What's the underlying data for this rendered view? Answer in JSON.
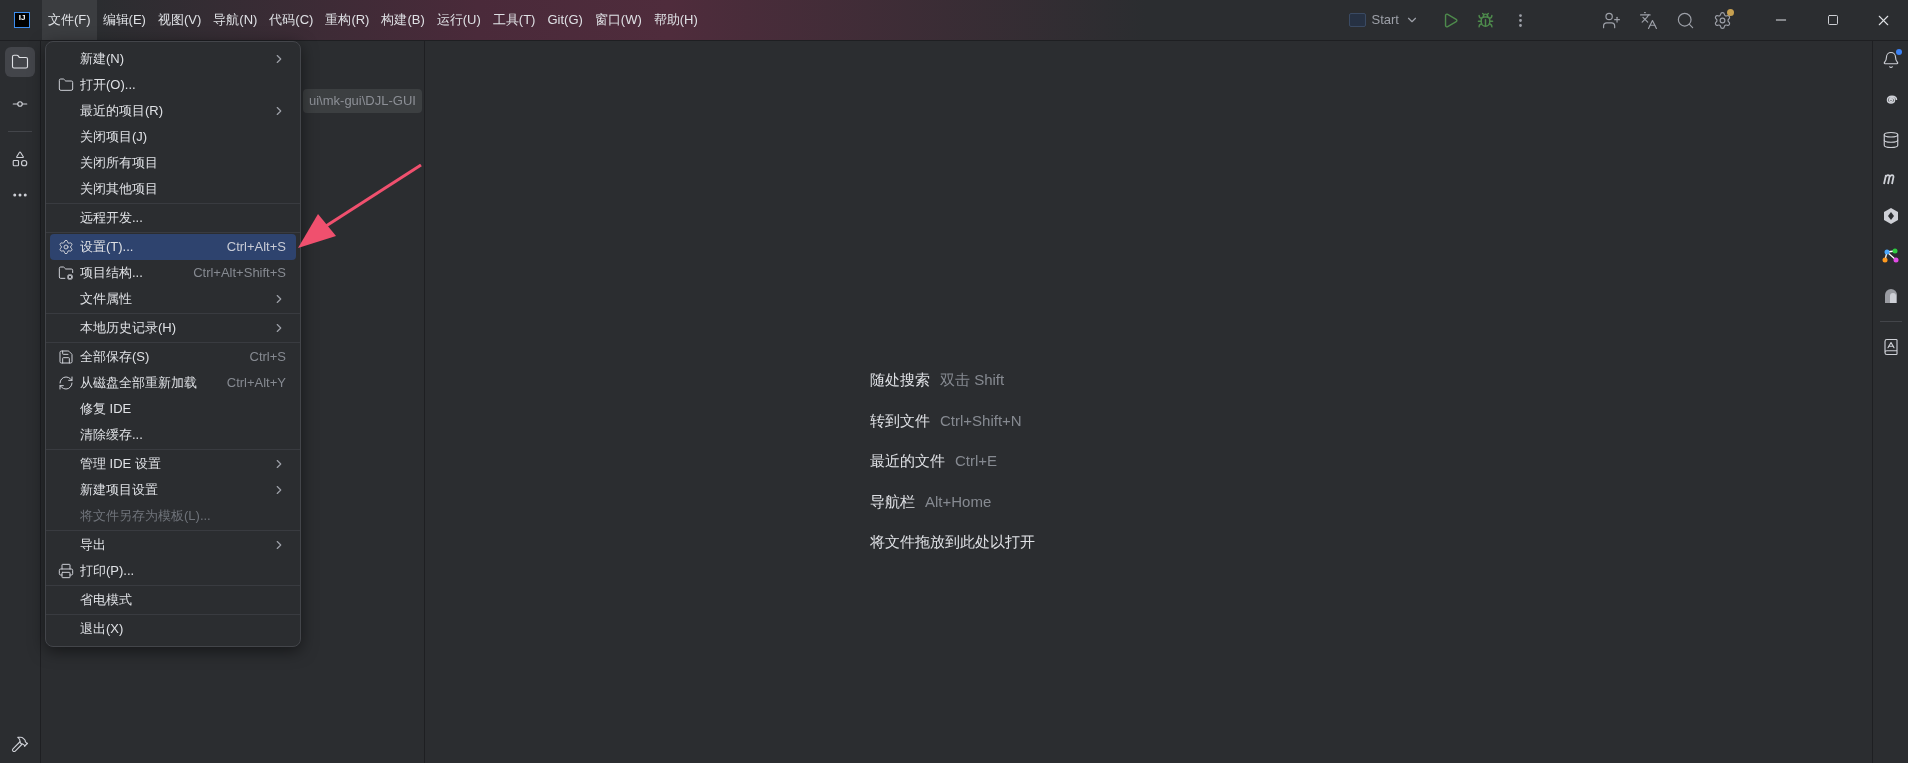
{
  "app_logo": {
    "text": "IJ"
  },
  "menu_bar": [
    {
      "label": "文件(F)",
      "selected": true
    },
    {
      "label": "编辑(E)",
      "selected": false
    },
    {
      "label": "视图(V)",
      "selected": false
    },
    {
      "label": "导航(N)",
      "selected": false
    },
    {
      "label": "代码(C)",
      "selected": false
    },
    {
      "label": "重构(R)",
      "selected": false
    },
    {
      "label": "构建(B)",
      "selected": false
    },
    {
      "label": "运行(U)",
      "selected": false
    },
    {
      "label": "工具(T)",
      "selected": false
    },
    {
      "label": "Git(G)",
      "selected": false
    },
    {
      "label": "窗口(W)",
      "selected": false
    },
    {
      "label": "帮助(H)",
      "selected": false
    }
  ],
  "run_config": {
    "label": "Start"
  },
  "project_path": "ui\\mk-gui\\DJL-GUI",
  "file_menu": [
    {
      "kind": "plain",
      "label": "新建(N)",
      "submenu": true,
      "selected": false,
      "disabled": false
    },
    {
      "kind": "folder",
      "label": "打开(O)...",
      "submenu": false,
      "selected": false,
      "disabled": false
    },
    {
      "kind": "plain",
      "label": "最近的项目(R)",
      "submenu": true,
      "selected": false,
      "disabled": false
    },
    {
      "kind": "plain",
      "label": "关闭项目(J)",
      "submenu": false,
      "selected": false,
      "disabled": false
    },
    {
      "kind": "plain",
      "label": "关闭所有项目",
      "submenu": false,
      "selected": false,
      "disabled": false
    },
    {
      "kind": "plain",
      "label": "关闭其他项目",
      "submenu": false,
      "selected": false,
      "disabled": false
    },
    {
      "kind": "separator"
    },
    {
      "kind": "plain",
      "label": "远程开发...",
      "submenu": false,
      "selected": false,
      "disabled": false
    },
    {
      "kind": "separator"
    },
    {
      "kind": "gear",
      "label": "设置(T)...",
      "shortcut": "Ctrl+Alt+S",
      "submenu": false,
      "selected": true,
      "disabled": false
    },
    {
      "kind": "structure",
      "label": "项目结构...",
      "shortcut": "Ctrl+Alt+Shift+S",
      "submenu": false,
      "selected": false,
      "disabled": false
    },
    {
      "kind": "plain",
      "label": "文件属性",
      "submenu": true,
      "selected": false,
      "disabled": false
    },
    {
      "kind": "separator"
    },
    {
      "kind": "plain",
      "label": "本地历史记录(H)",
      "submenu": true,
      "selected": false,
      "disabled": false
    },
    {
      "kind": "separator"
    },
    {
      "kind": "save",
      "label": "全部保存(S)",
      "shortcut": "Ctrl+S",
      "submenu": false,
      "selected": false,
      "disabled": false
    },
    {
      "kind": "reload",
      "label": "从磁盘全部重新加载",
      "shortcut": "Ctrl+Alt+Y",
      "submenu": false,
      "selected": false,
      "disabled": false
    },
    {
      "kind": "plain",
      "label": "修复 IDE",
      "submenu": false,
      "selected": false,
      "disabled": false
    },
    {
      "kind": "plain",
      "label": "清除缓存...",
      "submenu": false,
      "selected": false,
      "disabled": false
    },
    {
      "kind": "separator"
    },
    {
      "kind": "plain",
      "label": "管理 IDE 设置",
      "submenu": true,
      "selected": false,
      "disabled": false
    },
    {
      "kind": "plain",
      "label": "新建项目设置",
      "submenu": true,
      "selected": false,
      "disabled": false
    },
    {
      "kind": "plain",
      "label": "将文件另存为模板(L)...",
      "submenu": false,
      "selected": false,
      "disabled": true
    },
    {
      "kind": "separator"
    },
    {
      "kind": "plain",
      "label": "导出",
      "submenu": true,
      "selected": false,
      "disabled": false
    },
    {
      "kind": "print",
      "label": "打印(P)...",
      "submenu": false,
      "selected": false,
      "disabled": false
    },
    {
      "kind": "separator"
    },
    {
      "kind": "plain",
      "label": "省电模式",
      "submenu": false,
      "selected": false,
      "disabled": false
    },
    {
      "kind": "separator"
    },
    {
      "kind": "plain",
      "label": "退出(X)",
      "submenu": false,
      "selected": false,
      "disabled": false
    }
  ],
  "editor_hints": [
    {
      "action": "随处搜索",
      "shortcut": "双击 Shift"
    },
    {
      "action": "转到文件",
      "shortcut": "Ctrl+Shift+N"
    },
    {
      "action": "最近的文件",
      "shortcut": "Ctrl+E"
    },
    {
      "action": "导航栏",
      "shortcut": "Alt+Home"
    },
    {
      "action": "将文件拖放到此处以打开"
    }
  ]
}
